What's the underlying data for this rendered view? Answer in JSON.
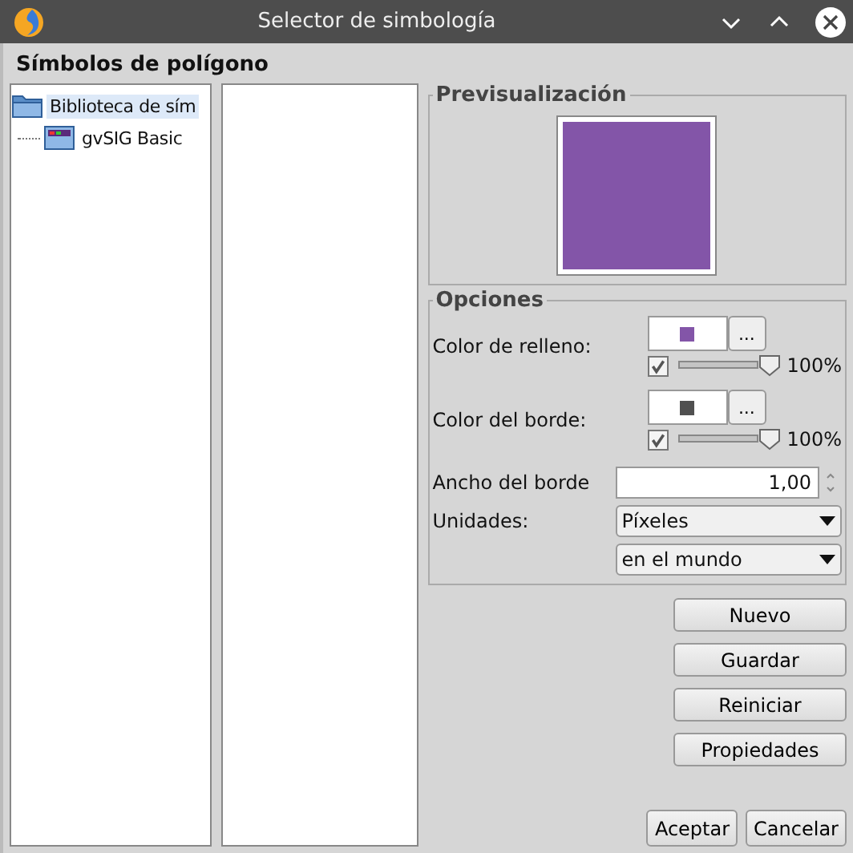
{
  "window": {
    "title": "Selector de simbología"
  },
  "heading": "Símbolos de polígono",
  "tree": {
    "items": [
      {
        "label": "Biblioteca de sím",
        "selected": true,
        "expanded": true,
        "children": [
          {
            "label": "gvSIG Basic",
            "selected": false
          }
        ]
      }
    ]
  },
  "preview": {
    "title": "Previsualización",
    "color": "#8355a8"
  },
  "options": {
    "title": "Opciones",
    "colors": [
      {
        "label": "Color de relleno:",
        "color": "#8355a8",
        "button": "...",
        "checked": true,
        "level": 1,
        "reading": "100%"
      },
      {
        "label": "Color del borde:",
        "color": "#505050",
        "button": "...",
        "checked": true,
        "level": 1,
        "reading": "100%"
      }
    ],
    "width": {
      "label": "Ancho del borde",
      "value": "1,00"
    },
    "units": {
      "label": "Unidades:",
      "value": "Píxeles"
    },
    "reference": {
      "value": "en el mundo"
    }
  },
  "buttons": [
    "Nuevo",
    "Guardar",
    "Reiniciar",
    "Propiedades"
  ],
  "footer_buttons": [
    "Aceptar",
    "Cancelar"
  ]
}
